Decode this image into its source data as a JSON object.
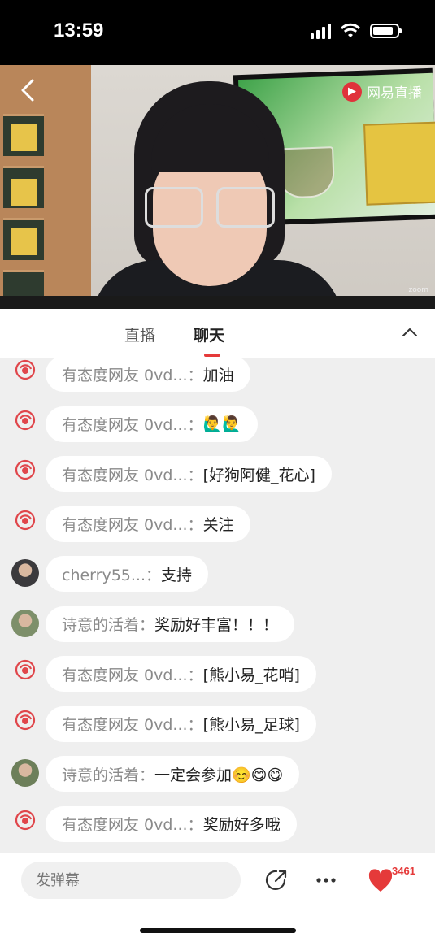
{
  "status_bar": {
    "time": "13:59"
  },
  "video": {
    "brand": "网易直播",
    "zoom_label": "zoom"
  },
  "tabs": [
    {
      "label": "直播"
    },
    {
      "label": "聊天"
    }
  ],
  "active_tab": "聊天",
  "messages": [
    {
      "avatar": "netease-logo-avatar",
      "name": "有态度网友 0vd...：",
      "text": "加油"
    },
    {
      "avatar": "netease-logo-avatar",
      "name": "有态度网友 0vd...：",
      "text": "🙋‍♂️🙋‍♂️"
    },
    {
      "avatar": "netease-logo-avatar",
      "name": "有态度网友 0vd...：",
      "text": "[好狗阿健_花心]"
    },
    {
      "avatar": "netease-logo-avatar",
      "name": "有态度网友 0vd...：",
      "text": "关注"
    },
    {
      "avatar": "user-photo-avatar",
      "name": "cherry55...：",
      "text": "支持"
    },
    {
      "avatar": "user-photo-avatar",
      "name": "诗意的活着：",
      "text": "奖励好丰富！！！"
    },
    {
      "avatar": "netease-logo-avatar",
      "name": "有态度网友 0vd...：",
      "text": "[熊小易_花哨]"
    },
    {
      "avatar": "netease-logo-avatar",
      "name": "有态度网友 0vd...：",
      "text": "[熊小易_足球]"
    },
    {
      "avatar": "user-photo-avatar",
      "name": "诗意的活着：",
      "text": "一定会参加☺️😋😋"
    },
    {
      "avatar": "netease-logo-avatar",
      "name": "有态度网友 0vd...：",
      "text": "奖励好多哦"
    }
  ],
  "bottom_bar": {
    "input_placeholder": "发弹幕",
    "like_count": "3461"
  },
  "colors": {
    "accent": "#e53a3a",
    "chat_background": "#efefef"
  }
}
